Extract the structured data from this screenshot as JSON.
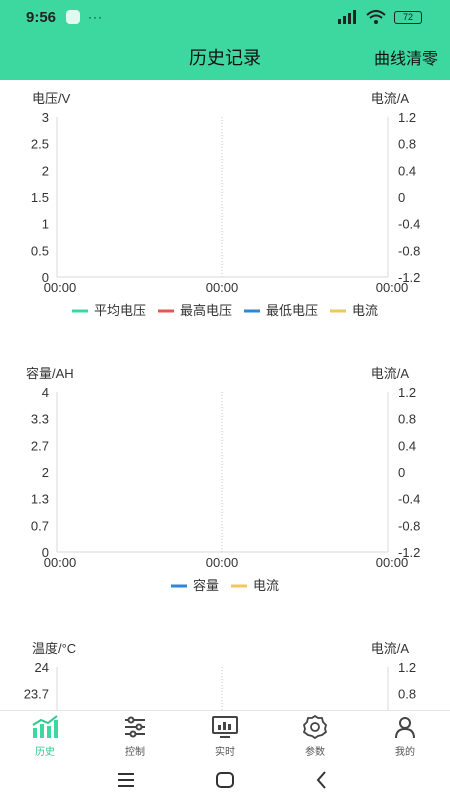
{
  "status_bar": {
    "time": "9:56",
    "more": "···",
    "battery": "72"
  },
  "header": {
    "title": "历史记录",
    "action": "曲线清零"
  },
  "charts": [
    {
      "left_axis_label": "电压/V",
      "right_axis_label": "电流/A",
      "left_ticks": [
        "3",
        "2.5",
        "2",
        "1.5",
        "1",
        "0.5",
        "0"
      ],
      "right_ticks": [
        "1.2",
        "0.8",
        "0.4",
        "0",
        "-0.4",
        "-0.8",
        "-1.2"
      ],
      "x_ticks": [
        "00:00",
        "00:00",
        "00:00"
      ],
      "legend": [
        {
          "label": "平均电压",
          "color": "#3dd8a0"
        },
        {
          "label": "最高电压",
          "color": "#e05a4f"
        },
        {
          "label": "最低电压",
          "color": "#2f86d6"
        },
        {
          "label": "电流",
          "color": "#f0c75e"
        }
      ]
    },
    {
      "left_axis_label": "容量/AH",
      "right_axis_label": "电流/A",
      "left_ticks": [
        "4",
        "3.3",
        "2.7",
        "2",
        "1.3",
        "0.7",
        "0"
      ],
      "right_ticks": [
        "1.2",
        "0.8",
        "0.4",
        "0",
        "-0.4",
        "-0.8",
        "-1.2"
      ],
      "x_ticks": [
        "00:00",
        "00:00",
        "00:00"
      ],
      "legend": [
        {
          "label": "容量",
          "color": "#2f86d6"
        },
        {
          "label": "电流",
          "color": "#f0c75e"
        }
      ]
    },
    {
      "left_axis_label": "温度/°C",
      "right_axis_label": "电流/A",
      "left_ticks": [
        "24",
        "23.7"
      ],
      "right_ticks": [
        "1.2",
        "0.8"
      ],
      "x_ticks": [],
      "legend": []
    }
  ],
  "tabs": [
    {
      "label": "历史",
      "icon": "bar-chart-icon",
      "active": true
    },
    {
      "label": "控制",
      "icon": "sliders-icon",
      "active": false
    },
    {
      "label": "实时",
      "icon": "monitor-icon",
      "active": false
    },
    {
      "label": "参数",
      "icon": "gear-icon",
      "active": false
    },
    {
      "label": "我的",
      "icon": "user-icon",
      "active": false
    }
  ],
  "colors": {
    "accent": "#3dd8a0",
    "active_tab": "#2fc98e"
  }
}
